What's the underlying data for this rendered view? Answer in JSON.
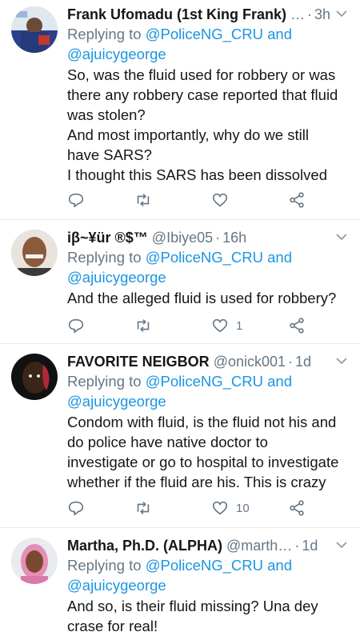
{
  "reply_prefix": "Replying to",
  "tweets": [
    {
      "name": "Frank Ufomadu (1st King Frank)",
      "name_suffix": "…",
      "handle": "",
      "time": "3h",
      "mentions": [
        "@PoliceNG_CRU",
        "and",
        "@ajuicygeorge"
      ],
      "text": [
        "So, was the fluid used for robbery or was",
        "there any robbery case reported that fluid",
        "was stolen?",
        "And most importantly, why do we still",
        "have SARS?",
        "I thought this SARS has been dissolved"
      ],
      "likes": "",
      "icons": [
        "reply-icon",
        "retweet-icon",
        "like-icon",
        "share-icon"
      ]
    },
    {
      "name": "iβ~¥ür ®$™",
      "handle": "@Ibiye05",
      "time": "16h",
      "mentions": [
        "@PoliceNG_CRU",
        "and",
        "@ajuicygeorge"
      ],
      "text": [
        "And the alleged fluid is used for robbery?"
      ],
      "likes": "1"
    },
    {
      "name": "FAVORITE NEIGBOR",
      "handle": "@onick001",
      "time": "1d",
      "mentions": [
        "@PoliceNG_CRU",
        "and",
        "@ajuicygeorge"
      ],
      "text": [
        "Condom with fluid, is the fluid not his and",
        "do police have native doctor to",
        "investigate or go to hospital to investigate",
        "whether if the fluid are his. This is crazy"
      ],
      "likes": "10"
    },
    {
      "name": "Martha, Ph.D. (ALPHA)",
      "handle": "@marth…",
      "time": "1d",
      "mentions": [
        "@PoliceNG_CRU",
        "and",
        "@ajuicygeorge"
      ],
      "text": [
        "And so, is their fluid missing? Una dey",
        "crase for real!"
      ],
      "likes": ""
    }
  ],
  "colors": {
    "link": "#1b95e0",
    "muted": "#657786",
    "text": "#14171a",
    "divider": "#e6ecf0"
  }
}
